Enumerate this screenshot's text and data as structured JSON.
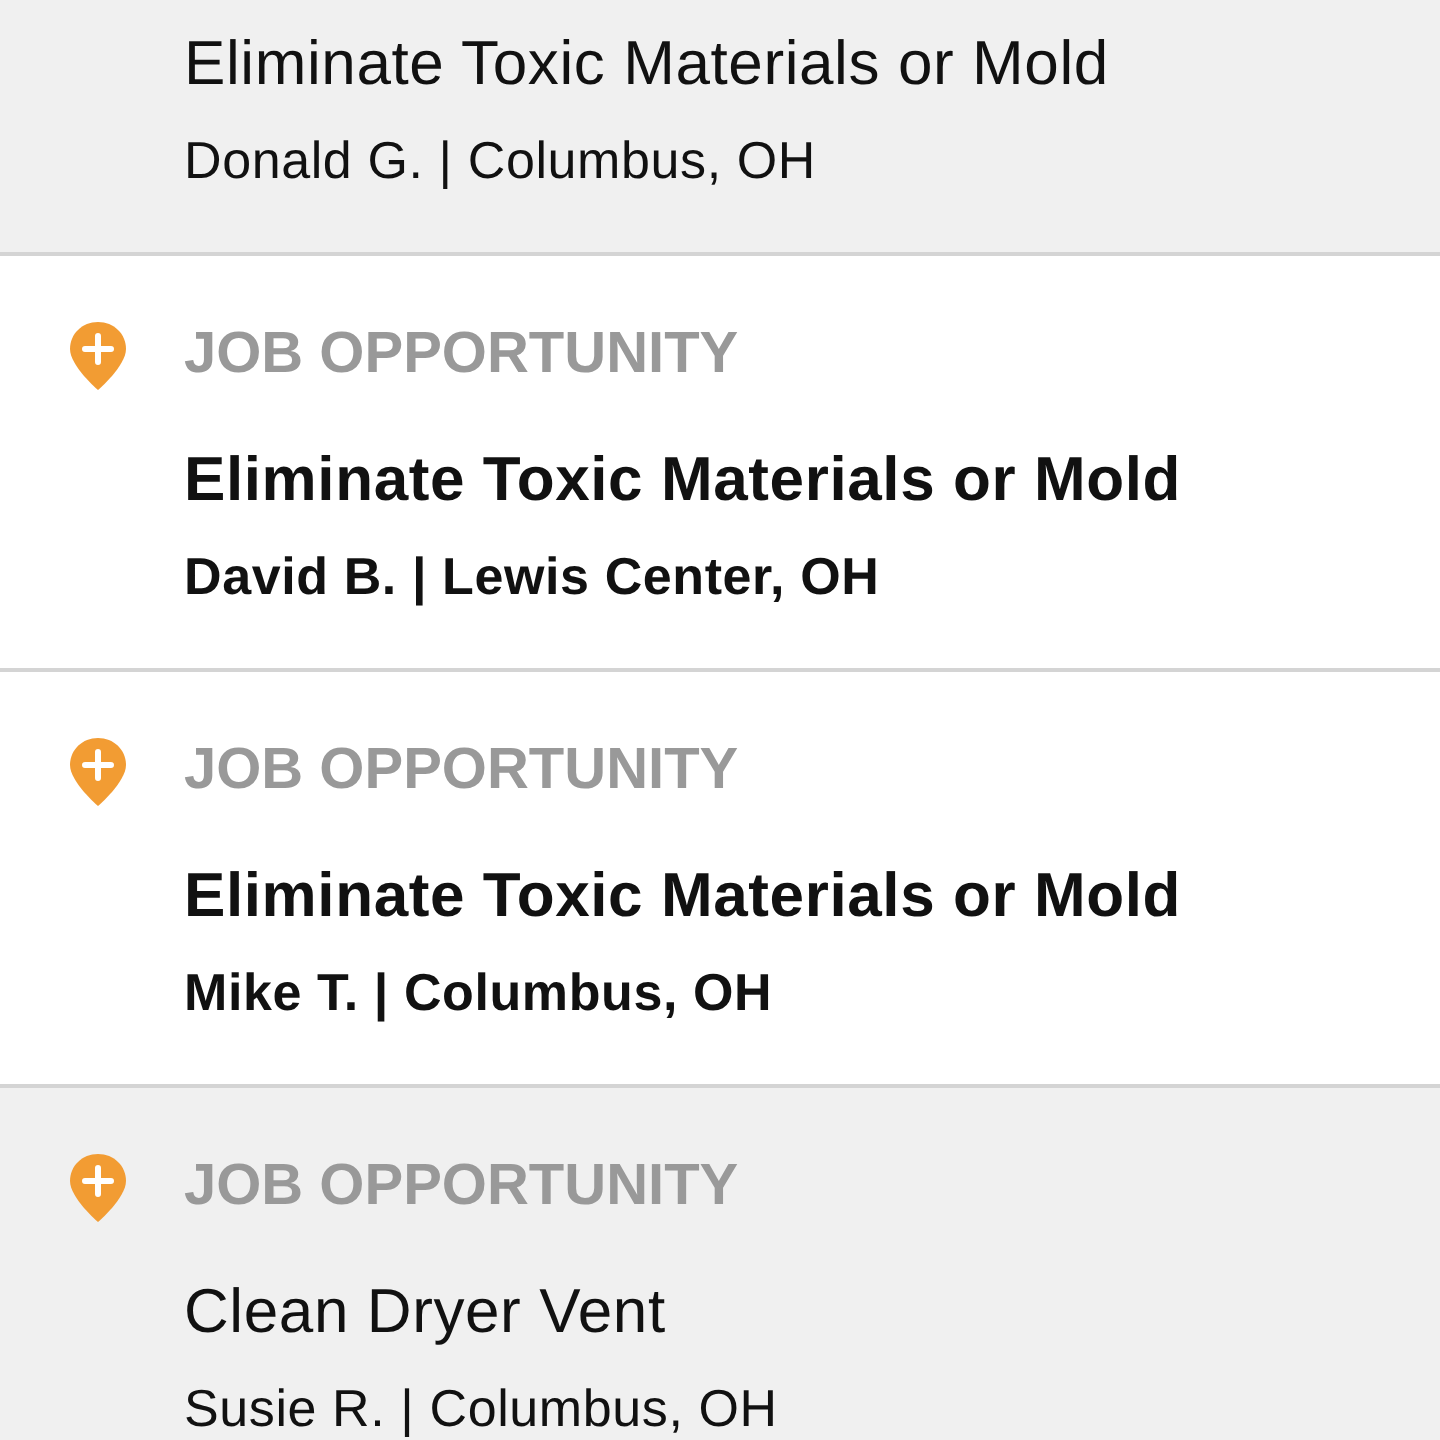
{
  "items": [
    {
      "title": "Eliminate Toxic Materials or Mold",
      "subtitle": "Donald G. | Columbus, OH",
      "unread": false
    },
    {
      "label": "JOB OPPORTUNITY",
      "title": "Eliminate Toxic Materials or Mold",
      "subtitle": "David B. | Lewis Center, OH",
      "unread": true
    },
    {
      "label": "JOB OPPORTUNITY",
      "title": "Eliminate Toxic Materials or Mold",
      "subtitle": "Mike T. | Columbus, OH",
      "unread": true
    },
    {
      "label": "JOB OPPORTUNITY",
      "title": "Clean Dryer Vent",
      "subtitle": "Susie R. | Columbus, OH",
      "unread": false
    }
  ]
}
